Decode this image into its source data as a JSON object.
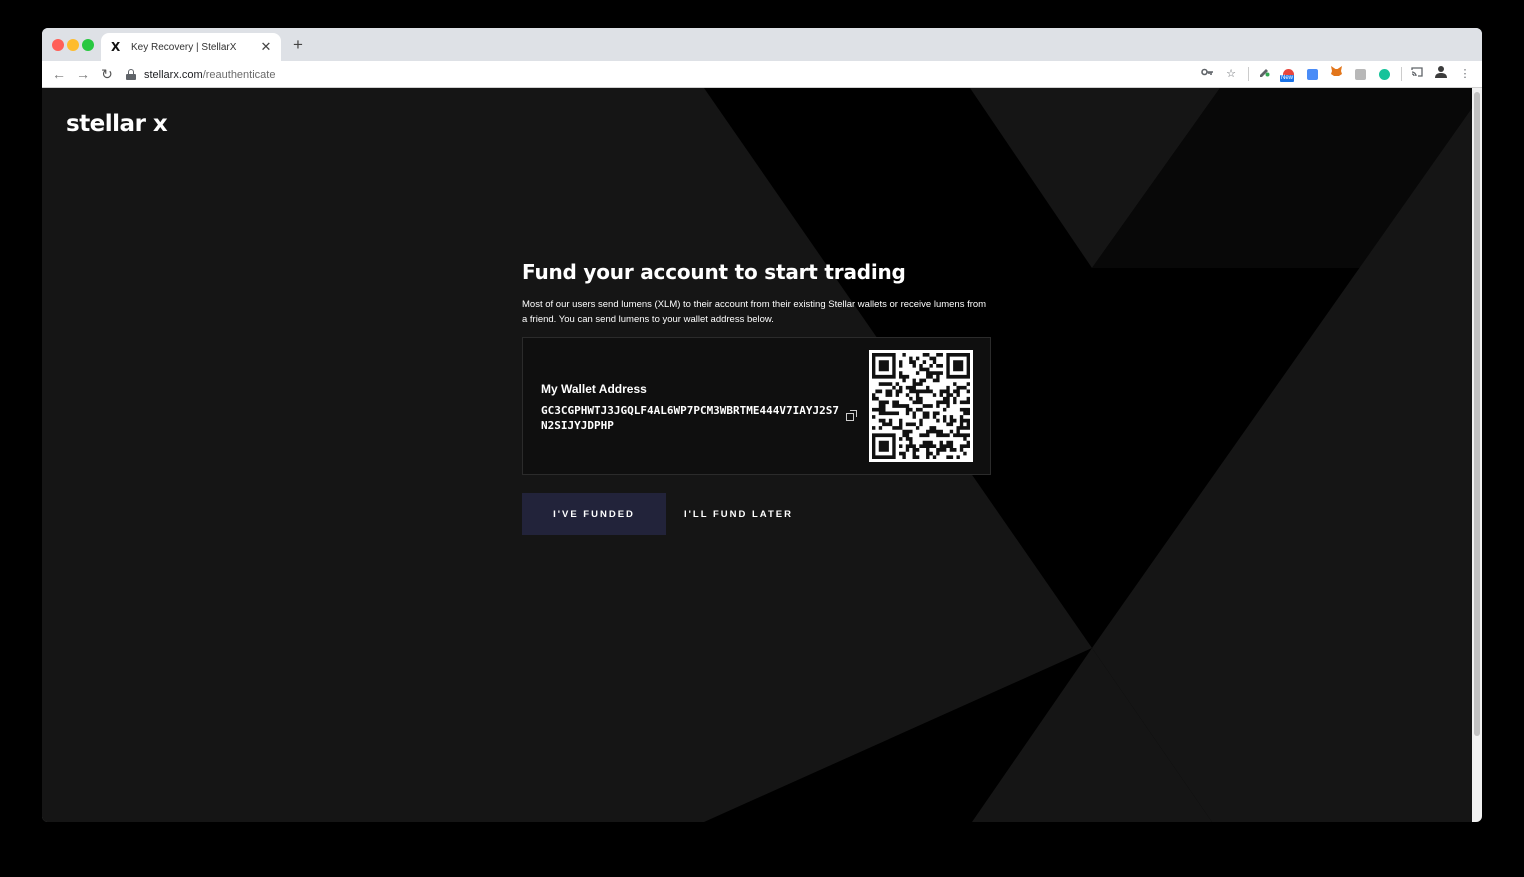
{
  "browser": {
    "tab": {
      "favicon": "X",
      "title": "Key Recovery | StellarX",
      "close": "✕"
    },
    "new_tab": "+",
    "url_host": "stellarx.com",
    "url_path": "/reauthenticate",
    "toolbar_icons": [
      "key-icon",
      "star-icon",
      "eyedropper-extension-icon",
      "new-extension-icon",
      "translate-extension-icon",
      "metamask-fox-icon",
      "k-extension-icon",
      "grammarly-icon",
      "cast-icon",
      "profile-icon",
      "more-menu-icon"
    ],
    "new_badge": "New"
  },
  "page": {
    "logo": "stellar x",
    "headline": "Fund your account to start trading",
    "intro": "Most of our users send lumens (XLM) to their account from their existing Stellar wallets or receive lumens from a friend. You can send lumens to your wallet address below.",
    "wallet": {
      "label": "My Wallet Address",
      "address": "GC3CGPHWTJ3JGQLF4AL6WP7PCM3WBRTME444V7IAYJ2S7N2SIJYJDPHP"
    },
    "buttons": {
      "funded": "I'VE FUNDED",
      "later": "I'LL FUND LATER"
    }
  },
  "colors": {
    "background": "#000000",
    "card": "#0f0f0f",
    "primary_button": "#22233a",
    "bg_shape": "#151515"
  }
}
